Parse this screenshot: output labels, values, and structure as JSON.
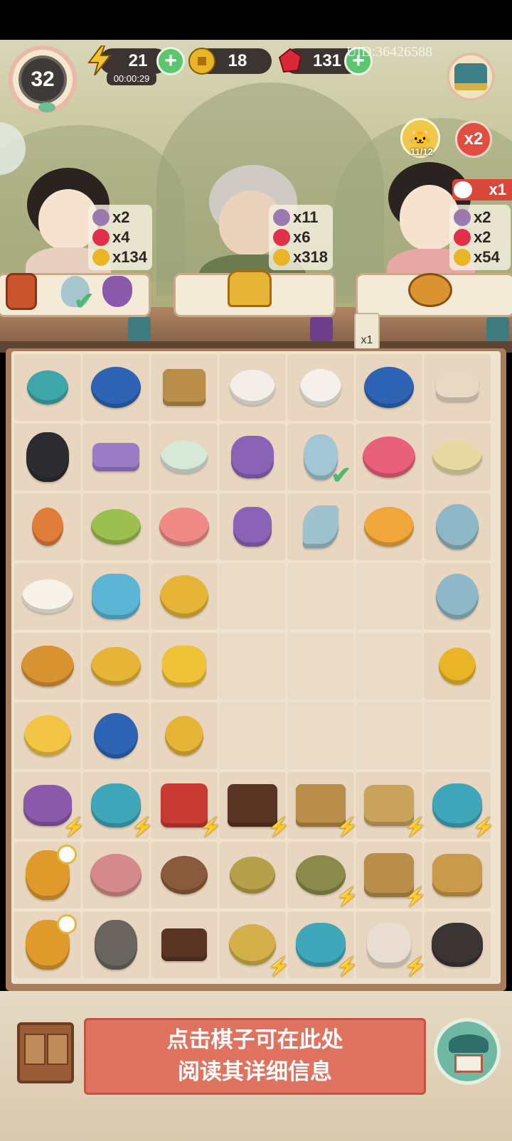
{
  "hud": {
    "level": "32",
    "energy": "21",
    "energy_timer": "00:00:29",
    "coins": "18",
    "gems": "131",
    "uid": "UID:36426588"
  },
  "bonus": {
    "cat_progress": "11/12",
    "multiplier": "x2",
    "customer_bonus": "x1"
  },
  "customers": [
    {
      "name": "customer-1",
      "items": [
        "x2",
        "x4",
        "x134"
      ]
    },
    {
      "name": "customer-2",
      "items": [
        "x11",
        "x6",
        "x318"
      ]
    },
    {
      "name": "customer-3",
      "items": [
        "x2",
        "x2",
        "x54"
      ]
    }
  ],
  "scroll_count": "x1",
  "info": {
    "line1": "点击棋子可在此处",
    "line2": "阅读其详细信息"
  },
  "board": [
    [
      "jar",
      "tea-bowl",
      "tea-box",
      "cotton-bowl",
      "cotton",
      "tea-bowl",
      "spindle"
    ],
    [
      "black-cat",
      "cloth",
      "porridge",
      "purple-pouch",
      "jade-pendant",
      "flower-cake",
      "bean-soup"
    ],
    [
      "egg",
      "green-soup",
      "pink-cake",
      "small-pouch",
      "jade-leaf",
      "fried-rice",
      "jade-ring"
    ],
    [
      "fried-egg",
      "butterfly-pin",
      "gold-bracelet",
      "",
      "",
      "",
      "jade-ring"
    ],
    [
      "roast-chicken",
      "jade-bracelet",
      "gold-flowers",
      "",
      "",
      "",
      "gold-coin"
    ],
    [
      "egg-rice",
      "tea-cup",
      "gold-ring",
      "",
      "",
      "",
      ""
    ],
    [
      "thread-spool",
      "teapot",
      "scroll-box",
      "treasure-chest",
      "book-crate",
      "fruit-tray",
      "teapot"
    ],
    [
      "hen-nest",
      "rabbit-bowl",
      "egg-nest",
      "basket",
      "yarn-basket",
      "melon-stand",
      "brushes"
    ],
    [
      "hen-nest",
      "tabby-cat",
      "wood-box",
      "rice-basket",
      "teapot",
      "spool",
      "sleeping-cat"
    ]
  ],
  "colors": {
    "energy": "#f2c230",
    "coin": "#e9b526",
    "gem": "#d8283a",
    "plus": "#5dc56f",
    "info_bg": "#e0735f"
  }
}
